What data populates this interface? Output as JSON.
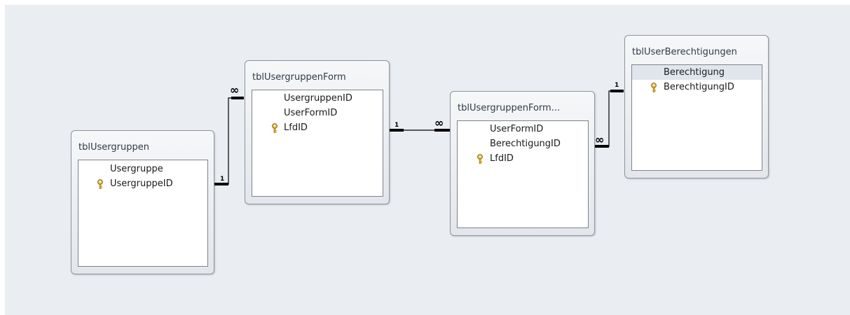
{
  "tables": {
    "usergruppen": {
      "title": "tblUsergruppen",
      "fields": [
        "Usergruppe",
        "UsergruppeID"
      ]
    },
    "usergruppenform": {
      "title": "tblUsergruppenForm",
      "fields": [
        "UsergruppenID",
        "UserFormID",
        "LfdID"
      ]
    },
    "usergruppenform2": {
      "title": "tblUsergruppenForm...",
      "fields": [
        "UserFormID",
        "BerechtigungID",
        "LfdID"
      ]
    },
    "berechtigungen": {
      "title": "tblUserBerechtigungen",
      "fields": [
        "Berechtigung",
        "BerechtigungID"
      ]
    }
  },
  "relationships": [
    {
      "one_side": "1",
      "many_side": "∞"
    },
    {
      "one_side": "1",
      "many_side": "∞"
    },
    {
      "one_side": "1",
      "many_side": "∞"
    }
  ],
  "icons": {
    "primary_key": "key-icon"
  },
  "colors": {
    "canvas": "#eaedf1",
    "key": "#d9ad2b"
  }
}
